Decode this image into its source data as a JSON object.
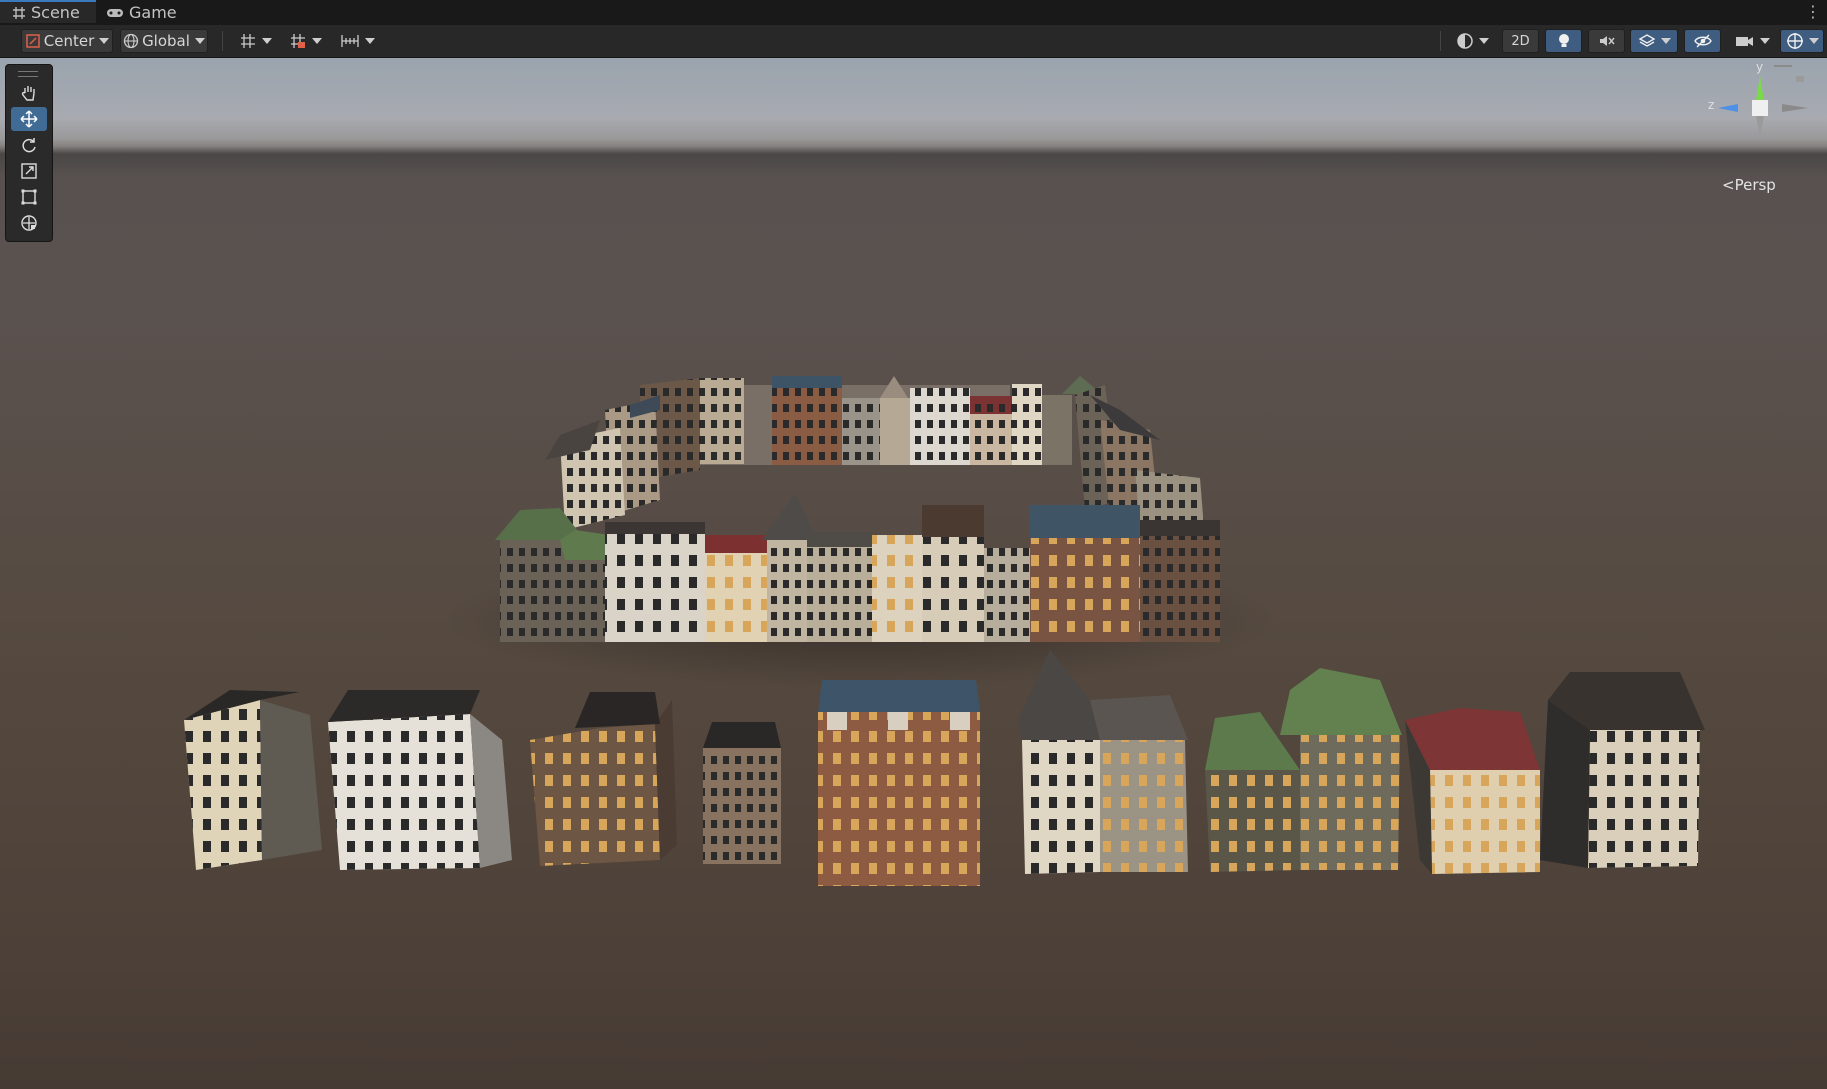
{
  "tabs": [
    {
      "label": "Scene",
      "icon": "grid-icon",
      "active": true
    },
    {
      "label": "Game",
      "icon": "gamepad-icon",
      "active": false
    }
  ],
  "toolbar": {
    "pivot_label": "Center",
    "space_label": "Global",
    "mode_2d_label": "2D"
  },
  "gizmo": {
    "y_label": "y",
    "z_label": "z",
    "projection_label": "Persp"
  },
  "colors": {
    "accent": "#3f6b95",
    "axis_y": "#7bd94c",
    "axis_z": "#4e8fe8"
  }
}
